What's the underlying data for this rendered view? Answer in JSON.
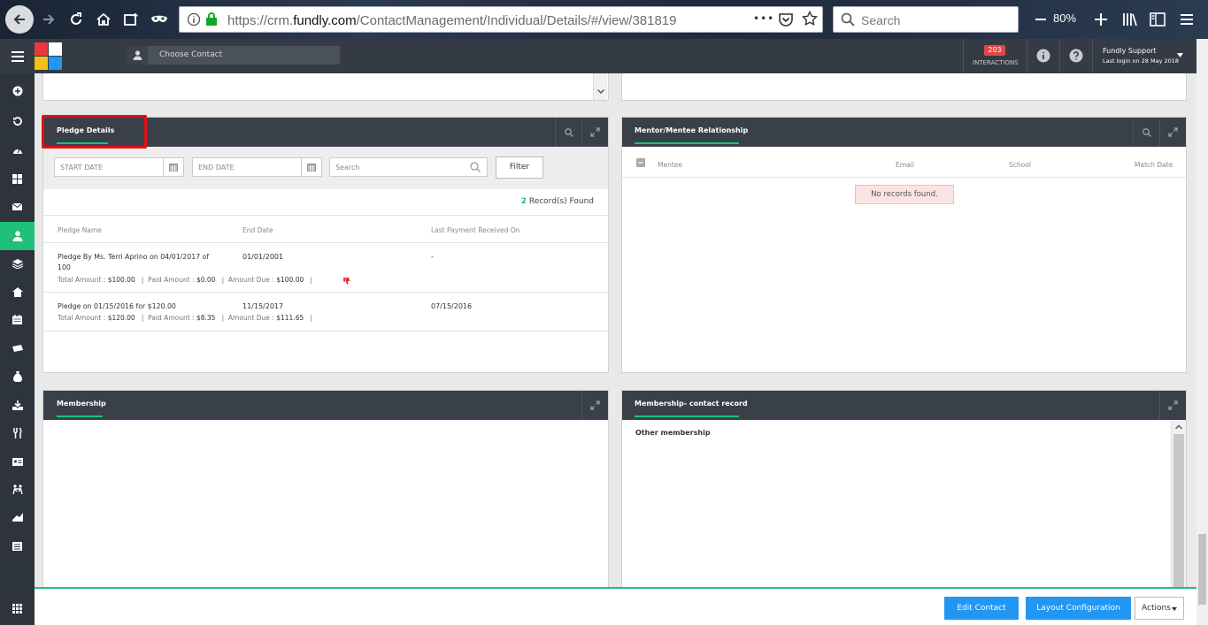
{
  "browser": {
    "url_prefix": "https://crm.",
    "url_domain": "fundly.com",
    "url_path": "/ContactManagement/Individual/Details/#/view/381819",
    "more_label": "•••",
    "search_placeholder": "Search",
    "zoom": "80%"
  },
  "header": {
    "choose_contact_placeholder": "Choose Contact",
    "interactions_count": "203",
    "interactions_label": "INTERACTIONS",
    "user_name": "Fundly Support",
    "last_login": "Last login on 28 May 2018"
  },
  "pledge": {
    "title": "Pledge Details",
    "start_date_placeholder": "START DATE",
    "end_date_placeholder": "END DATE",
    "search_placeholder": "Search",
    "filter_label": "Filter",
    "records_count": "2",
    "records_label": "Record(s) Found",
    "columns": [
      "Pledge Name",
      "End Date",
      "Last Payment Received On"
    ],
    "rows": [
      {
        "name_line1": "Pledge By Ms. Terri Aprino on 04/01/2017 of",
        "name_line2": "100",
        "end_date": "01/01/2001",
        "last_payment": "-",
        "total_label": "Total Amount :",
        "total": "$100.00",
        "paid_label": "Paid Amount :",
        "paid": "$0.00",
        "due_label": "Amount Due :",
        "due": "$100.00",
        "sep": "|"
      },
      {
        "name_line1": "Pledge on 01/15/2016 for $120.00",
        "name_line2": "",
        "end_date": "11/15/2017",
        "last_payment": "07/15/2016",
        "total_label": "Total Amount :",
        "total": "$120.00",
        "paid_label": "Paid Amount :",
        "paid": "$8.35",
        "due_label": "Amount Due :",
        "due": "$111.65",
        "sep": "|"
      }
    ]
  },
  "mentor": {
    "title": "Mentor/Mentee Relationship",
    "columns": [
      "Mentee",
      "Email",
      "School",
      "Match Date"
    ],
    "empty_message": "No records found."
  },
  "membership": {
    "title": "Membership"
  },
  "membership_contact": {
    "title": "Membership- contact record",
    "subtitle": "Other membership"
  },
  "footer": {
    "edit_contact": "Edit Contact",
    "layout_configuration": "Layout Configuration",
    "actions": "Actions"
  },
  "colors": {
    "accent": "#1ec07a",
    "primary_button": "#2196f3",
    "header_bg": "#353b44",
    "highlight_box": "#e01010"
  }
}
